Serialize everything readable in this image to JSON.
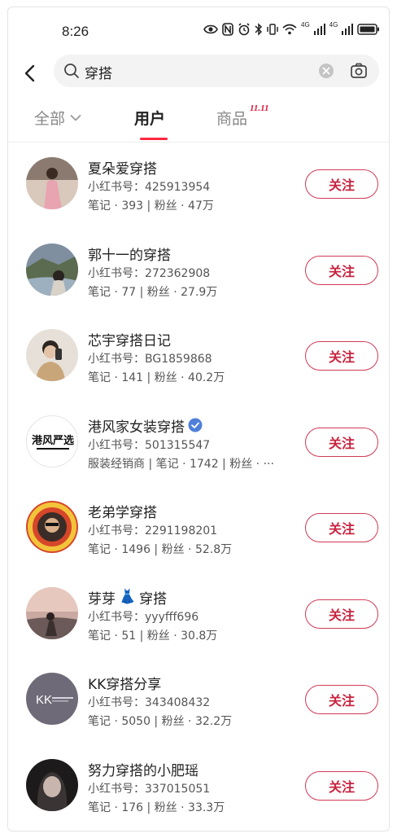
{
  "status_bar": {
    "time": "8:26",
    "net1": "4G",
    "net2": "4G"
  },
  "search": {
    "query": "穿搭"
  },
  "tabs": {
    "all": "全部",
    "users": "用户",
    "goods": "商品",
    "goods_badge": "11.11"
  },
  "follow_label": "关注",
  "users": [
    {
      "name": "夏朵爱穿搭",
      "id": "小红书号：425913954",
      "stats": "笔记 · 393 | 粉丝 · 47万"
    },
    {
      "name": "郭十一的穿搭",
      "id": "小红书号：272362908",
      "stats": "笔记 · 77 | 粉丝 · 27.9万"
    },
    {
      "name": "芯宇穿搭日记",
      "id": "小红书号：BG1859868",
      "stats": "笔记 · 141 | 粉丝 · 40.2万"
    },
    {
      "name": "港风家女装穿搭",
      "id": "小红书号：501315547",
      "stats": "服装经销商 | 笔记 · 1742 | 粉丝 · ···",
      "verified": true,
      "avatar_text": "港风严选"
    },
    {
      "name": "老弟学穿搭",
      "id": "小红书号：2291198201",
      "stats": "笔记 · 1496 | 粉丝 · 52.8万"
    },
    {
      "name": "芽芽",
      "name_emoji": "👗",
      "name_suffix": "穿搭",
      "id": "小红书号：yyyfff696",
      "stats": "笔记 · 51 | 粉丝 · 30.8万"
    },
    {
      "name": "KK穿搭分享",
      "id": "小红书号：343408432",
      "stats": "笔记 · 5050 | 粉丝 · 32.2万",
      "avatar_text": "KK"
    },
    {
      "name": "努力穿搭的小肥瑶",
      "id": "小红书号：337015051",
      "stats": "笔记 · 176 | 粉丝 · 33.3万"
    }
  ]
}
